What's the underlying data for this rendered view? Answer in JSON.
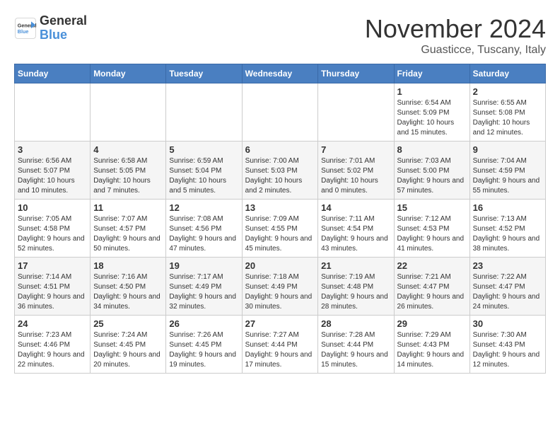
{
  "logo": {
    "line1": "General",
    "line2": "Blue"
  },
  "title": "November 2024",
  "subtitle": "Guasticce, Tuscany, Italy",
  "days_of_week": [
    "Sunday",
    "Monday",
    "Tuesday",
    "Wednesday",
    "Thursday",
    "Friday",
    "Saturday"
  ],
  "weeks": [
    [
      {
        "day": "",
        "info": ""
      },
      {
        "day": "",
        "info": ""
      },
      {
        "day": "",
        "info": ""
      },
      {
        "day": "",
        "info": ""
      },
      {
        "day": "",
        "info": ""
      },
      {
        "day": "1",
        "info": "Sunrise: 6:54 AM\nSunset: 5:09 PM\nDaylight: 10 hours and 15 minutes."
      },
      {
        "day": "2",
        "info": "Sunrise: 6:55 AM\nSunset: 5:08 PM\nDaylight: 10 hours and 12 minutes."
      }
    ],
    [
      {
        "day": "3",
        "info": "Sunrise: 6:56 AM\nSunset: 5:07 PM\nDaylight: 10 hours and 10 minutes."
      },
      {
        "day": "4",
        "info": "Sunrise: 6:58 AM\nSunset: 5:05 PM\nDaylight: 10 hours and 7 minutes."
      },
      {
        "day": "5",
        "info": "Sunrise: 6:59 AM\nSunset: 5:04 PM\nDaylight: 10 hours and 5 minutes."
      },
      {
        "day": "6",
        "info": "Sunrise: 7:00 AM\nSunset: 5:03 PM\nDaylight: 10 hours and 2 minutes."
      },
      {
        "day": "7",
        "info": "Sunrise: 7:01 AM\nSunset: 5:02 PM\nDaylight: 10 hours and 0 minutes."
      },
      {
        "day": "8",
        "info": "Sunrise: 7:03 AM\nSunset: 5:00 PM\nDaylight: 9 hours and 57 minutes."
      },
      {
        "day": "9",
        "info": "Sunrise: 7:04 AM\nSunset: 4:59 PM\nDaylight: 9 hours and 55 minutes."
      }
    ],
    [
      {
        "day": "10",
        "info": "Sunrise: 7:05 AM\nSunset: 4:58 PM\nDaylight: 9 hours and 52 minutes."
      },
      {
        "day": "11",
        "info": "Sunrise: 7:07 AM\nSunset: 4:57 PM\nDaylight: 9 hours and 50 minutes."
      },
      {
        "day": "12",
        "info": "Sunrise: 7:08 AM\nSunset: 4:56 PM\nDaylight: 9 hours and 47 minutes."
      },
      {
        "day": "13",
        "info": "Sunrise: 7:09 AM\nSunset: 4:55 PM\nDaylight: 9 hours and 45 minutes."
      },
      {
        "day": "14",
        "info": "Sunrise: 7:11 AM\nSunset: 4:54 PM\nDaylight: 9 hours and 43 minutes."
      },
      {
        "day": "15",
        "info": "Sunrise: 7:12 AM\nSunset: 4:53 PM\nDaylight: 9 hours and 41 minutes."
      },
      {
        "day": "16",
        "info": "Sunrise: 7:13 AM\nSunset: 4:52 PM\nDaylight: 9 hours and 38 minutes."
      }
    ],
    [
      {
        "day": "17",
        "info": "Sunrise: 7:14 AM\nSunset: 4:51 PM\nDaylight: 9 hours and 36 minutes."
      },
      {
        "day": "18",
        "info": "Sunrise: 7:16 AM\nSunset: 4:50 PM\nDaylight: 9 hours and 34 minutes."
      },
      {
        "day": "19",
        "info": "Sunrise: 7:17 AM\nSunset: 4:49 PM\nDaylight: 9 hours and 32 minutes."
      },
      {
        "day": "20",
        "info": "Sunrise: 7:18 AM\nSunset: 4:49 PM\nDaylight: 9 hours and 30 minutes."
      },
      {
        "day": "21",
        "info": "Sunrise: 7:19 AM\nSunset: 4:48 PM\nDaylight: 9 hours and 28 minutes."
      },
      {
        "day": "22",
        "info": "Sunrise: 7:21 AM\nSunset: 4:47 PM\nDaylight: 9 hours and 26 minutes."
      },
      {
        "day": "23",
        "info": "Sunrise: 7:22 AM\nSunset: 4:47 PM\nDaylight: 9 hours and 24 minutes."
      }
    ],
    [
      {
        "day": "24",
        "info": "Sunrise: 7:23 AM\nSunset: 4:46 PM\nDaylight: 9 hours and 22 minutes."
      },
      {
        "day": "25",
        "info": "Sunrise: 7:24 AM\nSunset: 4:45 PM\nDaylight: 9 hours and 20 minutes."
      },
      {
        "day": "26",
        "info": "Sunrise: 7:26 AM\nSunset: 4:45 PM\nDaylight: 9 hours and 19 minutes."
      },
      {
        "day": "27",
        "info": "Sunrise: 7:27 AM\nSunset: 4:44 PM\nDaylight: 9 hours and 17 minutes."
      },
      {
        "day": "28",
        "info": "Sunrise: 7:28 AM\nSunset: 4:44 PM\nDaylight: 9 hours and 15 minutes."
      },
      {
        "day": "29",
        "info": "Sunrise: 7:29 AM\nSunset: 4:43 PM\nDaylight: 9 hours and 14 minutes."
      },
      {
        "day": "30",
        "info": "Sunrise: 7:30 AM\nSunset: 4:43 PM\nDaylight: 9 hours and 12 minutes."
      }
    ]
  ]
}
